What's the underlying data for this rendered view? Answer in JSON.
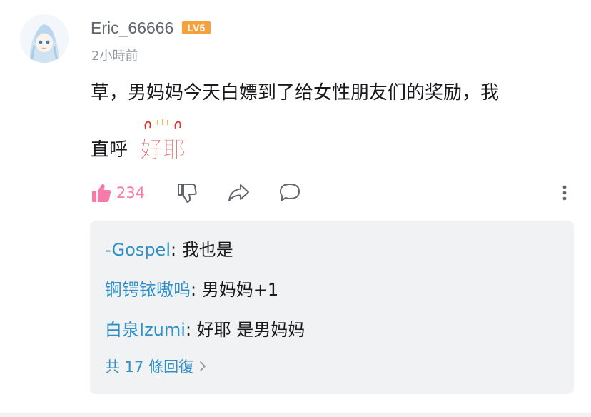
{
  "comment": {
    "username": "Eric_66666",
    "level": "LV5",
    "timestamp": "2小時前",
    "text_line1": "草，男妈妈今天白嫖到了给女性朋友们的奖励，我",
    "text_line2": "直呼",
    "emote_text": "好耶",
    "like_count": "234"
  },
  "replies": [
    {
      "name": "-Gospel",
      "sep": ": ",
      "text": "我也是"
    },
    {
      "name": "锕锷铱嗷呜",
      "sep": ": ",
      "text": "男妈妈+1"
    },
    {
      "name": "白泉Izumi",
      "sep": ": ",
      "text": "好耶 是男妈妈"
    }
  ],
  "more_replies": "共 17 條回復",
  "colors": {
    "accent_link": "#2f8fc6",
    "like": "#f77ba6",
    "level_badge": "#f6a13b",
    "emote_red": "#e0312f"
  },
  "icons": [
    "thumbs-up-icon",
    "thumbs-down-icon",
    "share-icon",
    "comment-icon",
    "more-vertical-icon",
    "chevron-right-icon"
  ]
}
